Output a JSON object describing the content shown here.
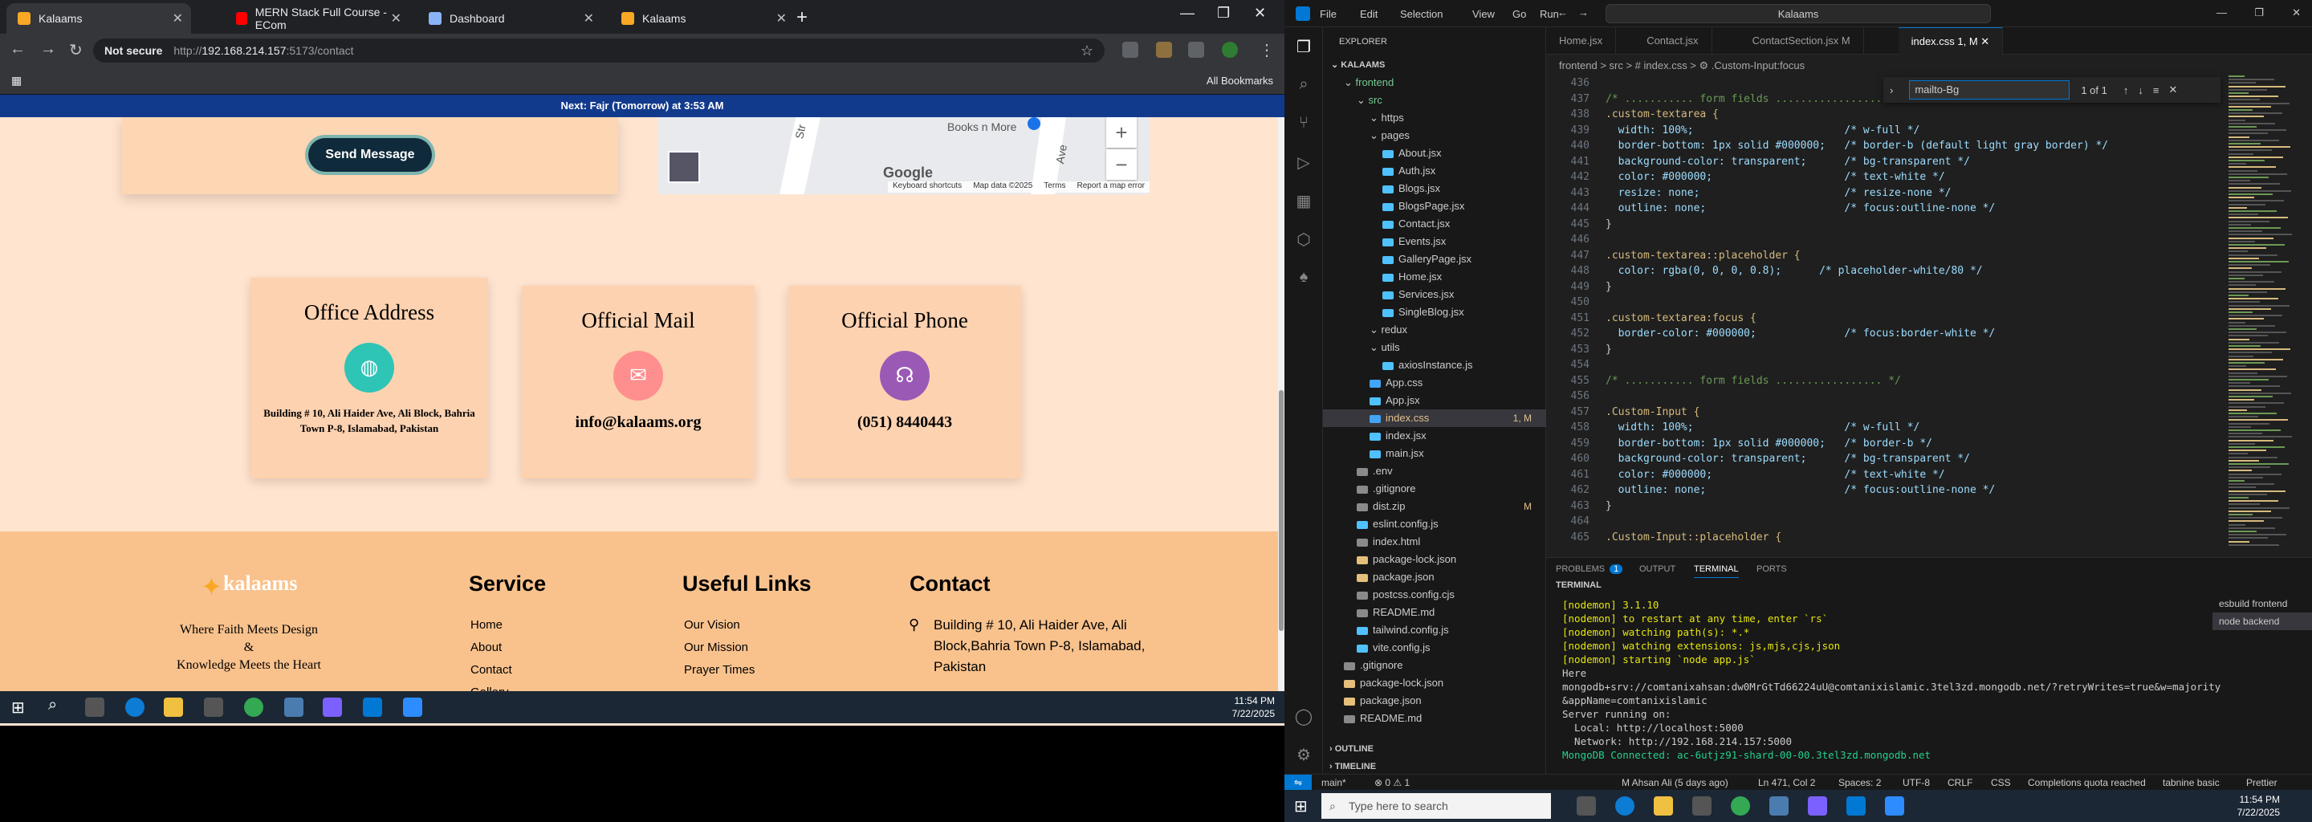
{
  "browser": {
    "tabs": [
      {
        "label": "Kalaams",
        "color": "#f9a825",
        "active": true
      },
      {
        "label": "MERN Stack Full Course - ECom",
        "color": "#ff0000",
        "active": false
      },
      {
        "label": "Dashboard",
        "color": "#8ab4f8",
        "active": false
      },
      {
        "label": "Kalaams",
        "color": "#f9a825",
        "active": false
      }
    ],
    "not_secure": "Not secure",
    "url_prefix": "http://",
    "url_host": "192.168.214.157",
    "url_rest": ":5173/contact",
    "all_bookmarks": "All Bookmarks",
    "notice": "Next: Fajr (Tomorrow) at 3:53 AM"
  },
  "page": {
    "send_button": "Send Message",
    "map": {
      "place": "Books n More",
      "street1": "Str",
      "street2": "Ave",
      "google": "Google",
      "footer": [
        "Keyboard shortcuts",
        "Map data ©2025",
        "Terms",
        "Report a map error"
      ]
    },
    "cards": [
      {
        "title": "Office Address",
        "icon": "globe-icon",
        "color": "#2ec4b6",
        "value": "Building # 10, Ali Haider Ave, Ali Block, Bahria Town P-8, Islamabad, Pakistan"
      },
      {
        "title": "Official Mail",
        "icon": "mail-icon",
        "color": "#ff8e8e",
        "value": "info@kalaams.org"
      },
      {
        "title": "Official Phone",
        "icon": "headset-icon",
        "color": "#9b59b6",
        "value": "(051) 8440443"
      }
    ],
    "footer": {
      "brand": "kalaams",
      "tagline": [
        "Where Faith Meets Design",
        "&",
        "Knowledge Meets the Heart"
      ],
      "service_title": "Service",
      "service_links": [
        "Home",
        "About",
        "Contact",
        "Gallery"
      ],
      "useful_title": "Useful Links",
      "useful_links": [
        "Our Vision",
        "Our Mission",
        "Prayer Times"
      ],
      "contact_title": "Contact",
      "contact_address": "Building # 10, Ali Haider Ave, Ali Block,Bahria Town P-8, Islamabad, Pakistan"
    }
  },
  "left_taskbar": {
    "time": "11:54 PM",
    "date": "7/22/2025"
  },
  "vscode": {
    "menu": [
      "File",
      "Edit",
      "Selection",
      "View",
      "Go",
      "Run"
    ],
    "search": "Kalaams",
    "explorer_title": "EXPLORER",
    "tree": [
      {
        "label": "KALAAMS",
        "indent": 0,
        "kind": "root"
      },
      {
        "label": "frontend",
        "indent": 1,
        "kind": "folder",
        "color": "#73c991"
      },
      {
        "label": "src",
        "indent": 2,
        "kind": "folder",
        "color": "#73c991"
      },
      {
        "label": "https",
        "indent": 3,
        "kind": "folder"
      },
      {
        "label": "pages",
        "indent": 3,
        "kind": "folder"
      },
      {
        "label": "About.jsx",
        "indent": 4,
        "kind": "file"
      },
      {
        "label": "Auth.jsx",
        "indent": 4,
        "kind": "file"
      },
      {
        "label": "Blogs.jsx",
        "indent": 4,
        "kind": "file"
      },
      {
        "label": "BlogsPage.jsx",
        "indent": 4,
        "kind": "file"
      },
      {
        "label": "Contact.jsx",
        "indent": 4,
        "kind": "file"
      },
      {
        "label": "Events.jsx",
        "indent": 4,
        "kind": "file"
      },
      {
        "label": "GalleryPage.jsx",
        "indent": 4,
        "kind": "file"
      },
      {
        "label": "Home.jsx",
        "indent": 4,
        "kind": "file"
      },
      {
        "label": "Services.jsx",
        "indent": 4,
        "kind": "file"
      },
      {
        "label": "SingleBlog.jsx",
        "indent": 4,
        "kind": "file"
      },
      {
        "label": "redux",
        "indent": 3,
        "kind": "folder"
      },
      {
        "label": "utils",
        "indent": 3,
        "kind": "folder"
      },
      {
        "label": "axiosInstance.js",
        "indent": 4,
        "kind": "file"
      },
      {
        "label": "App.css",
        "indent": 3,
        "kind": "file"
      },
      {
        "label": "App.jsx",
        "indent": 3,
        "kind": "file"
      },
      {
        "label": "index.css",
        "indent": 3,
        "kind": "file",
        "badge": "1, M",
        "selected": true,
        "color": "#e2c08d"
      },
      {
        "label": "index.jsx",
        "indent": 3,
        "kind": "file"
      },
      {
        "label": "main.jsx",
        "indent": 3,
        "kind": "file"
      },
      {
        "label": ".env",
        "indent": 2,
        "kind": "file"
      },
      {
        "label": ".gitignore",
        "indent": 2,
        "kind": "file"
      },
      {
        "label": "dist.zip",
        "indent": 2,
        "kind": "file",
        "badge": "M"
      },
      {
        "label": "eslint.config.js",
        "indent": 2,
        "kind": "file"
      },
      {
        "label": "index.html",
        "indent": 2,
        "kind": "file"
      },
      {
        "label": "package-lock.json",
        "indent": 2,
        "kind": "file"
      },
      {
        "label": "package.json",
        "indent": 2,
        "kind": "file"
      },
      {
        "label": "postcss.config.cjs",
        "indent": 2,
        "kind": "file"
      },
      {
        "label": "README.md",
        "indent": 2,
        "kind": "file"
      },
      {
        "label": "tailwind.config.js",
        "indent": 2,
        "kind": "file"
      },
      {
        "label": "vite.config.js",
        "indent": 2,
        "kind": "file"
      },
      {
        "label": ".gitignore",
        "indent": 1,
        "kind": "file"
      },
      {
        "label": "package-lock.json",
        "indent": 1,
        "kind": "file"
      },
      {
        "label": "package.json",
        "indent": 1,
        "kind": "file"
      },
      {
        "label": "README.md",
        "indent": 1,
        "kind": "file"
      }
    ],
    "outline": "OUTLINE",
    "timeline": "TIMELINE",
    "editor_tabs": [
      {
        "label": "Home.jsx",
        "active": false
      },
      {
        "label": "Contact.jsx",
        "active": false
      },
      {
        "label": "ContactSection.jsx M",
        "active": false
      },
      {
        "label": "index.css 1, M",
        "active": true
      }
    ],
    "breadcrumbs": "frontend > src > # index.css > ⚙ .Custom-Input:focus",
    "find": {
      "query": "mailto-Bg",
      "count": "1 of 1"
    },
    "code": [
      {
        "n": "436",
        "t": ""
      },
      {
        "n": "437",
        "t": "/* ........... form fields ................. */"
      },
      {
        "n": "438",
        "t": ".custom-textarea {"
      },
      {
        "n": "439",
        "t": "  width: 100%;                        /* w-full */"
      },
      {
        "n": "440",
        "t": "  border-bottom: 1px solid #000000;   /* border-b (default light gray border) */"
      },
      {
        "n": "441",
        "t": "  background-color: transparent;      /* bg-transparent */"
      },
      {
        "n": "442",
        "t": "  color: #000000;                     /* text-white */"
      },
      {
        "n": "443",
        "t": "  resize: none;                       /* resize-none */"
      },
      {
        "n": "444",
        "t": "  outline: none;                      /* focus:outline-none */"
      },
      {
        "n": "445",
        "t": "}"
      },
      {
        "n": "446",
        "t": ""
      },
      {
        "n": "447",
        "t": ".custom-textarea::placeholder {"
      },
      {
        "n": "448",
        "t": "  color: rgba(0, 0, 0, 0.8);      /* placeholder-white/80 */"
      },
      {
        "n": "449",
        "t": "}"
      },
      {
        "n": "450",
        "t": ""
      },
      {
        "n": "451",
        "t": ".custom-textarea:focus {"
      },
      {
        "n": "452",
        "t": "  border-color: #000000;              /* focus:border-white */"
      },
      {
        "n": "453",
        "t": "}"
      },
      {
        "n": "454",
        "t": ""
      },
      {
        "n": "455",
        "t": "/* ........... form fields ................. */"
      },
      {
        "n": "456",
        "t": ""
      },
      {
        "n": "457",
        "t": ".Custom-Input {"
      },
      {
        "n": "458",
        "t": "  width: 100%;                        /* w-full */"
      },
      {
        "n": "459",
        "t": "  border-bottom: 1px solid #000000;   /* border-b */"
      },
      {
        "n": "460",
        "t": "  background-color: transparent;      /* bg-transparent */"
      },
      {
        "n": "461",
        "t": "  color: #000000;                     /* text-white */"
      },
      {
        "n": "462",
        "t": "  outline: none;                      /* focus:outline-none */"
      },
      {
        "n": "463",
        "t": "}"
      },
      {
        "n": "464",
        "t": ""
      },
      {
        "n": "465",
        "t": ".Custom-Input::placeholder {"
      }
    ],
    "panel_tabs": [
      "PROBLEMS",
      "OUTPUT",
      "TERMINAL",
      "PORTS"
    ],
    "problems_count": "1",
    "terminal_title": "TERMINAL",
    "terminal": [
      "[nodemon] 3.1.10",
      "[nodemon] to restart at any time, enter `rs`",
      "[nodemon] watching path(s): *.*",
      "[nodemon] watching extensions: js,mjs,cjs,json",
      "[nodemon] starting `node app.js`",
      "Here",
      "mongodb+srv://comtanixahsan:dw0MrGtTd66224uU@comtanixislamic.3tel3zd.mongodb.net/?retryWrites=true&w=majority",
      "&appName=comtanixislamic",
      "Server running on:",
      "  Local: http://localhost:5000",
      "  Network: http://192.168.214.157:5000",
      "MongoDB Connected: ac-6utjz91-shard-00-00.3tel3zd.mongodb.net"
    ],
    "terminals": [
      "esbuild frontend",
      "node backend"
    ],
    "status": {
      "branch": "main*",
      "problems": "⊗ 0 ⚠ 1",
      "author": "M Ahsan Ali (5 days ago)",
      "position": "Ln 471, Col 2",
      "spaces": "Spaces: 2",
      "encoding": "UTF-8",
      "eol": "CRLF",
      "lang": "CSS",
      "completions": "Completions quota reached",
      "tabnine": "tabnine basic",
      "prettier": "Prettier"
    }
  },
  "right_taskbar": {
    "search_placeholder": "Type here to search",
    "time": "11:54 PM",
    "date": "7/22/2025"
  }
}
